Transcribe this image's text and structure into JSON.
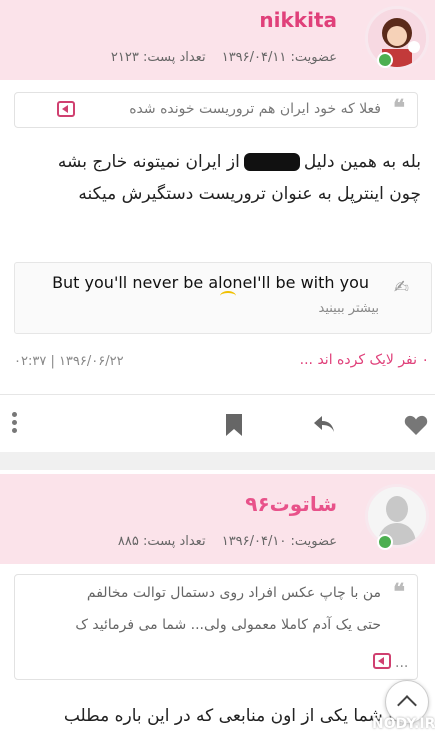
{
  "post1": {
    "username": "nikkita",
    "join_label": "عضویت: ۱۳۹۶/۰۴/۱۱",
    "posts_label": "تعداد پست: ۲۱۲۳",
    "quote": "فعلا که خود ایران هم تروریست خونده شده",
    "body_line1_a": "بله به همین دلیل",
    "body_line1_b": "از ایران نمیتونه خارج بشه",
    "body_line2": "چون اینترپل به عنوان تروریست دستگیرش میکنه",
    "signature": "But you'll never be aloneI'll be with you",
    "signature_more": "بیشتر ببینید",
    "likes": "۰ نفر لایک کرده اند ...",
    "date": "۰۲:۳۷ | ۱۳۹۶/۰۶/۲۲"
  },
  "post2": {
    "username": "شاتوت۹۶",
    "join_label": "عضویت: ۱۳۹۶/۰۴/۱۰",
    "posts_label": "تعداد پست: ۸۸۵",
    "quote_line1": "من با چاپ عکس افراد روی دستمال توالت مخالفم",
    "quote_line2": "حتی یک آدم کاملا معمولی ولی...    شما می فرمائید ک",
    "quote_dots": "...",
    "body_line1": "لطفا شما یکی از اون منابعی که در این باره مطلب"
  },
  "icons": {
    "heart": "heart-icon",
    "reply": "reply-icon",
    "bookmark": "bookmark-icon",
    "more": "more-vertical-icon",
    "quote": "quote-icon",
    "expand": "expand-quote-icon",
    "signature": "signature-icon",
    "scroll_top": "scroll-top-icon"
  },
  "watermark": "NODY.IR",
  "colors": {
    "header_bg": "#fbe3ea",
    "username": "#e0407a",
    "online": "#4caf50"
  }
}
